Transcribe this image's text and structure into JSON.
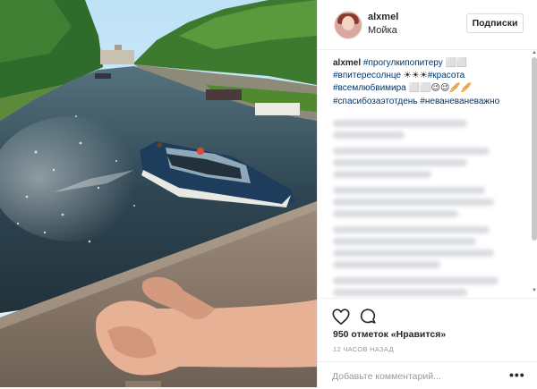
{
  "header": {
    "username": "alxmel",
    "location": "Мойка",
    "follow_label": "Подписки"
  },
  "caption": {
    "username": "alxmel",
    "hashtags": [
      "#прогулкипопитеру",
      "#впитересолнце",
      "#красота",
      "#всемлюбвимира",
      "#спасибозаэтотдень",
      "#неваневаневажно"
    ],
    "emoji_runs": [
      "⬜⬜",
      "☀☀☀",
      "⬜⬜😉😉🥖🥖"
    ]
  },
  "stats": {
    "likes": "950 отметок «Нравится»",
    "time": "12 ЧАСОВ НАЗАД"
  },
  "comment_box": {
    "placeholder": "Добавьте комментарий...",
    "more": "•••"
  },
  "icons": {
    "like": "heart-icon",
    "comment": "comment-icon",
    "more": "more-options-icon"
  },
  "colors": {
    "hashtag": "#003569",
    "border": "#efefef",
    "muted": "#999999"
  }
}
